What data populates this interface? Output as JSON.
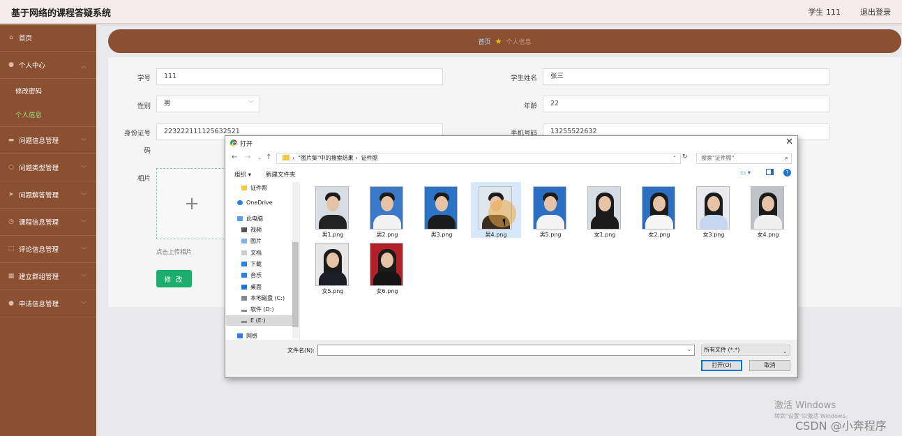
{
  "header": {
    "title": "基于网络的课程答疑系统",
    "user": "学生 111",
    "logout": "退出登录"
  },
  "sidebar": {
    "home": "首页",
    "personal_center": "个人中心",
    "personal_sub": [
      "修改密码",
      "个人信息"
    ],
    "items": [
      "问题信息管理",
      "问题类型管理",
      "问题解答管理",
      "课程信息管理",
      "评论信息管理",
      "建立群组管理",
      "申请信息管理"
    ]
  },
  "breadcrumb": {
    "home": "首页",
    "current": "个人信息"
  },
  "form": {
    "student_id_label": "学号",
    "student_id": "111",
    "name_label": "学生姓名",
    "name": "张三",
    "gender_label": "性别",
    "gender": "男",
    "age_label": "年龄",
    "age": "22",
    "idcard_label_1": "身份证号",
    "idcard_label_2": "码",
    "idcard": "223222111125632521",
    "phone_label": "手机号码",
    "phone": "13255522632",
    "photo_label": "相片",
    "upload_tip": "点击上传相片",
    "edit_button": "修 改"
  },
  "dialog": {
    "title": "打开",
    "path_1": "\"图片集\"中的搜索结果",
    "path_2": "证件照",
    "search_placeholder": "搜索\"证件照\"",
    "organize": "组织 ▾",
    "new_folder": "新建文件夹",
    "nav": [
      "证件照",
      "OneDrive",
      "此电脑",
      "视频",
      "图片",
      "文档",
      "下载",
      "音乐",
      "桌面",
      "本地磁盘 (C:)",
      "软件 (D:)",
      "E (E:)",
      "网络"
    ],
    "files": [
      "男1.png",
      "男2.png",
      "男3.png",
      "男4.png",
      "男5.png",
      "女1.png",
      "女2.png",
      "女3.png",
      "女4.png",
      "女5.png",
      "女6.png"
    ],
    "filename_label": "文件名(N):",
    "file_type": "所有文件 (*.*)",
    "open_button": "打开(O)",
    "cancel_button": "取消"
  },
  "overlay": {
    "activate_1": "激活 Windows",
    "activate_2": "转到\"设置\"以激活 Windows。",
    "watermark": "CSDN @小奔程序"
  }
}
